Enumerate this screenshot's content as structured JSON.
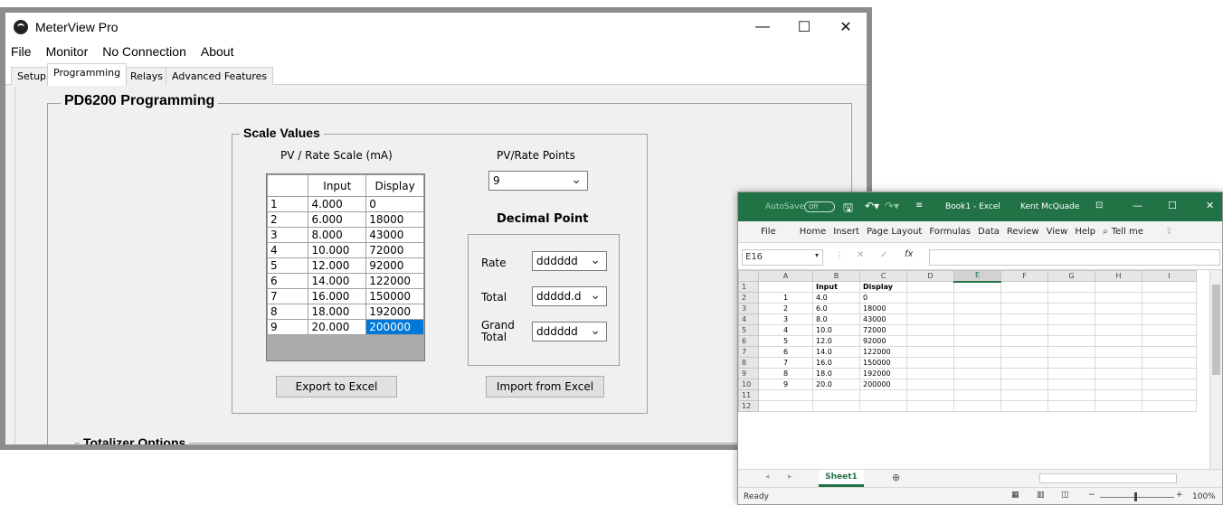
{
  "meterview": {
    "title": "MeterView Pro",
    "controls": {
      "minimize": "—",
      "maximize": "☐",
      "close": "✕"
    },
    "menu": [
      "File",
      "Monitor",
      "No Connection",
      "About"
    ],
    "tabs": [
      "Setup",
      "Programming",
      "Relays",
      "Advanced Features"
    ],
    "active_tab": "Programming",
    "group_title": "PD6200 Programming",
    "scale_values": {
      "title": "Scale Values",
      "scale_label": "PV / Rate Scale (mA)",
      "col_input": "Input",
      "col_display": "Display",
      "rows": [
        {
          "n": "1",
          "input": "4.000",
          "display": "0"
        },
        {
          "n": "2",
          "input": "6.000",
          "display": "18000"
        },
        {
          "n": "3",
          "input": "8.000",
          "display": "43000"
        },
        {
          "n": "4",
          "input": "10.000",
          "display": "72000"
        },
        {
          "n": "5",
          "input": "12.000",
          "display": "92000"
        },
        {
          "n": "6",
          "input": "14.000",
          "display": "122000"
        },
        {
          "n": "7",
          "input": "16.000",
          "display": "150000"
        },
        {
          "n": "8",
          "input": "18.000",
          "display": "192000"
        },
        {
          "n": "9",
          "input": "20.000",
          "display": "200000"
        }
      ],
      "points_label": "PV/Rate Points",
      "points_value": "9",
      "decimal_title": "Decimal Point",
      "rate_label": "Rate",
      "rate_value": "dddddd",
      "total_label": "Total",
      "total_value": "ddddd.d",
      "grand_label_1": "Grand",
      "grand_label_2": "Total",
      "grand_value": "dddddd",
      "export_button": "Export to Excel",
      "import_button": "Import from Excel"
    },
    "totalizer_title": "Totalizer Options"
  },
  "excel": {
    "autosave": "AutoSave",
    "autosave_state": "Off",
    "title": "Book1 - Excel",
    "user": "Kent McQuade",
    "controls": {
      "minimize": "—",
      "maximize": "☐",
      "close": "✕"
    },
    "ribbon": [
      "File",
      "Home",
      "Insert",
      "Page Layout",
      "Formulas",
      "Data",
      "Review",
      "View",
      "Help",
      "Tell me"
    ],
    "name_box": "E16",
    "columns": [
      "A",
      "B",
      "C",
      "D",
      "E",
      "F",
      "G",
      "H",
      "I"
    ],
    "rows": [
      {
        "r": "1",
        "A": "",
        "B": "Input",
        "C": "Display"
      },
      {
        "r": "2",
        "A": "1",
        "B": "4.0",
        "C": "0"
      },
      {
        "r": "3",
        "A": "2",
        "B": "6.0",
        "C": "18000"
      },
      {
        "r": "4",
        "A": "3",
        "B": "8.0",
        "C": "43000"
      },
      {
        "r": "5",
        "A": "4",
        "B": "10.0",
        "C": "72000"
      },
      {
        "r": "6",
        "A": "5",
        "B": "12.0",
        "C": "92000"
      },
      {
        "r": "7",
        "A": "6",
        "B": "14.0",
        "C": "122000"
      },
      {
        "r": "8",
        "A": "7",
        "B": "16.0",
        "C": "150000"
      },
      {
        "r": "9",
        "A": "8",
        "B": "18.0",
        "C": "192000"
      },
      {
        "r": "10",
        "A": "9",
        "B": "20.0",
        "C": "200000"
      },
      {
        "r": "11",
        "A": "",
        "B": "",
        "C": ""
      },
      {
        "r": "12",
        "A": "",
        "B": "",
        "C": ""
      }
    ],
    "sheet_tab": "Sheet1",
    "status": "Ready",
    "zoom": "100%"
  }
}
